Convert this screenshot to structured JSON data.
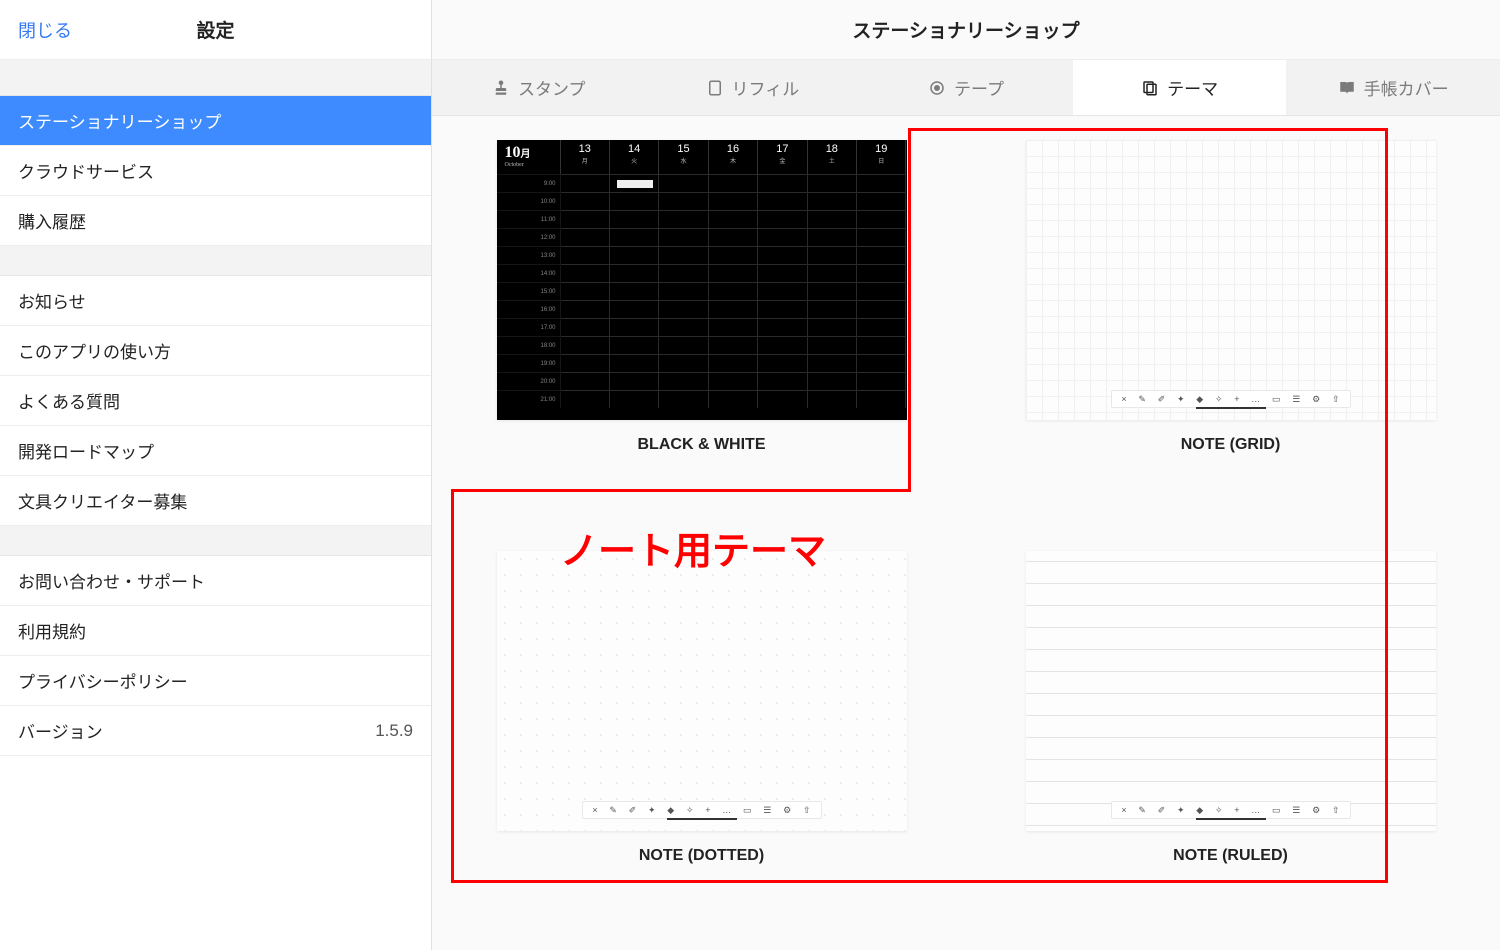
{
  "sidebar": {
    "close": "閉じる",
    "title": "設定",
    "group1": [
      {
        "label": "ステーショナリーショップ",
        "selected": true
      },
      {
        "label": "クラウドサービス"
      },
      {
        "label": "購入履歴"
      }
    ],
    "group2": [
      {
        "label": "お知らせ"
      },
      {
        "label": "このアプリの使い方"
      },
      {
        "label": "よくある質問"
      },
      {
        "label": "開発ロードマップ"
      },
      {
        "label": "文具クリエイター募集"
      }
    ],
    "group3": [
      {
        "label": "お問い合わせ・サポート"
      },
      {
        "label": "利用規約"
      },
      {
        "label": "プライバシーポリシー"
      },
      {
        "label": "バージョン",
        "value": "1.5.9"
      }
    ]
  },
  "main": {
    "title": "ステーショナリーショップ",
    "tabs": [
      {
        "label": "スタンプ",
        "icon": "stamp"
      },
      {
        "label": "リフィル",
        "icon": "refill"
      },
      {
        "label": "テープ",
        "icon": "tape"
      },
      {
        "label": "テーマ",
        "icon": "theme",
        "active": true
      },
      {
        "label": "手帳カバー",
        "icon": "cover"
      }
    ],
    "themes": [
      {
        "label": "BLACK & WHITE",
        "kind": "bw"
      },
      {
        "label": "NOTE (GRID)",
        "kind": "grid"
      },
      {
        "label": "NOTE (DOTTED)",
        "kind": "dotted"
      },
      {
        "label": "NOTE (RULED)",
        "kind": "ruled"
      }
    ],
    "bw": {
      "month": "10",
      "month_suffix": "月",
      "month_sub": "October",
      "days": [
        {
          "d": "13",
          "w": "月"
        },
        {
          "d": "14",
          "w": "火"
        },
        {
          "d": "15",
          "w": "水"
        },
        {
          "d": "16",
          "w": "木"
        },
        {
          "d": "17",
          "w": "金"
        },
        {
          "d": "18",
          "w": "土"
        },
        {
          "d": "19",
          "w": "日"
        }
      ]
    },
    "toolbar_icons": [
      "×",
      "✎",
      "✐",
      "✦",
      "◆",
      "✧",
      "+",
      "…",
      "▭",
      "☰",
      "⚙",
      "⇧"
    ]
  },
  "annotation": {
    "label": "ノート用テーマ"
  }
}
